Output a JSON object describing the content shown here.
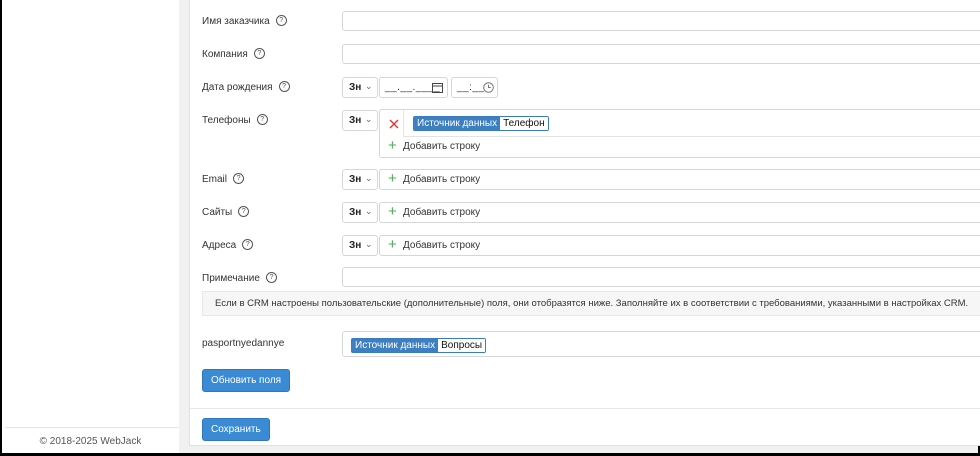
{
  "footer": {
    "copyright": "© 2018-2025 WebJack"
  },
  "fields": {
    "customer_name": {
      "label": "Имя заказчика"
    },
    "company": {
      "label": "Компания"
    },
    "birth_date": {
      "label": "Дата рождения",
      "lang": "Зн",
      "date_value": "__.__.____",
      "time_value": "__:__"
    },
    "phones": {
      "label": "Телефоны",
      "lang": "Зн",
      "tag_key": "Источник данных",
      "tag_value": "Телефон",
      "add_row": "Добавить строку"
    },
    "email": {
      "label": "Email",
      "lang": "Зн",
      "add_row": "Добавить строку"
    },
    "sites": {
      "label": "Сайты",
      "lang": "Зн",
      "add_row": "Добавить строку"
    },
    "addresses": {
      "label": "Адреса",
      "lang": "Зн",
      "add_row": "Добавить строку"
    },
    "note": {
      "label": "Примечание"
    }
  },
  "help_glyph": "?",
  "notice": "Если в CRM настроены пользовательские (дополнительные) поля, они отобразятся ниже. Заполняйте их в соответствии с требованиями, указанными в настройках CRM.",
  "custom_field": {
    "label": "pasportnyedannye",
    "tag_key": "Источник данных",
    "tag_value": "Вопросы"
  },
  "buttons": {
    "refresh_fields": "Обновить поля",
    "save": "Сохранить"
  },
  "colors": {
    "accent": "#3a8bd4",
    "tag_blue": "#3d7fc0",
    "remove_red": "#e53935",
    "add_green": "#4caf50"
  },
  "icons": {
    "remove": "close-icon",
    "add": "plus-icon",
    "calendar": "calendar-icon",
    "clock": "clock-icon",
    "dropdown": "chevron-down-icon",
    "help": "help-icon"
  }
}
